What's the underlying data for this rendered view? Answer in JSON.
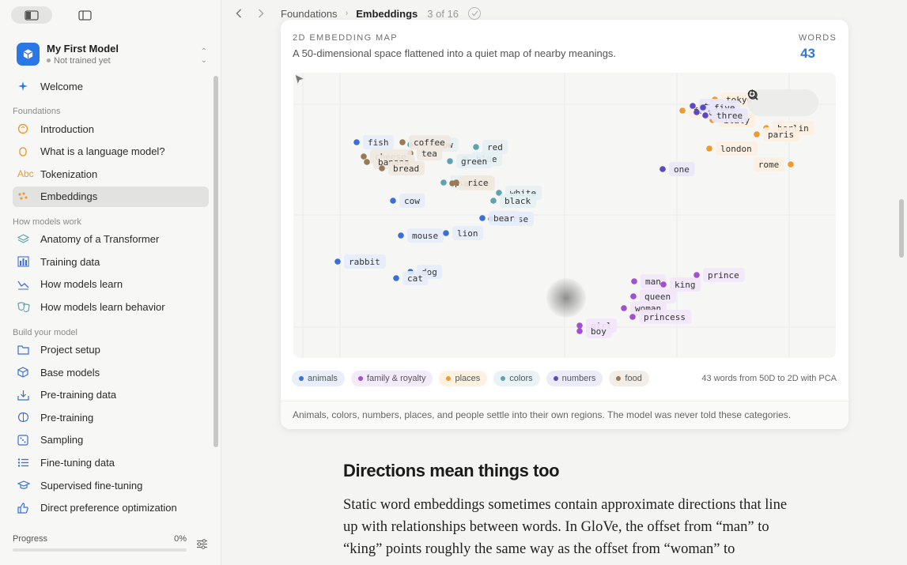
{
  "sidebar": {
    "model_name": "My First Model",
    "model_status": "Not trained yet",
    "welcome": "Welcome",
    "sections": [
      {
        "title": "Foundations",
        "items": [
          "Introduction",
          "What is a language model?",
          "Tokenization",
          "Embeddings"
        ]
      },
      {
        "title": "How models work",
        "items": [
          "Anatomy of a Transformer",
          "Training data",
          "How models learn",
          "How models learn behavior"
        ]
      },
      {
        "title": "Build your model",
        "items": [
          "Project setup",
          "Base models",
          "Pre-training data",
          "Pre-training",
          "Sampling",
          "Fine-tuning data",
          "Supervised fine-tuning",
          "Direct preference optimization"
        ]
      }
    ],
    "active_item": "Embeddings",
    "tokenization_icon_text": "Abc",
    "progress_label": "Progress",
    "progress_value": "0%",
    "progress_fraction": 0
  },
  "header": {
    "crumb_parent": "Foundations",
    "crumb_current": "Embeddings",
    "pager": "3 of 16"
  },
  "card": {
    "label": "2D EMBEDDING MAP",
    "subtitle": "A 50-dimensional space flattened into a quiet map of nearby meanings.",
    "words_label": "WORDS",
    "words_value": "43",
    "legend": [
      {
        "name": "animals",
        "color": "#3a6fd8"
      },
      {
        "name": "family & royalty",
        "color": "#a24fd1"
      },
      {
        "name": "places",
        "color": "#ef9a2f"
      },
      {
        "name": "colors",
        "color": "#5fa2b2"
      },
      {
        "name": "numbers",
        "color": "#5b48c4"
      },
      {
        "name": "food",
        "color": "#9a7a55"
      }
    ],
    "legend_note": "43 words from 50D to 2D with PCA",
    "footer": "Animals, colors, numbers, places, and people settle into their own regions. The model was never told these categories."
  },
  "chart_data": {
    "type": "scatter",
    "points": [
      {
        "word": "fish",
        "group": "animals"
      },
      {
        "word": "cow",
        "group": "animals"
      },
      {
        "word": "mouse",
        "group": "animals"
      },
      {
        "word": "lion",
        "group": "animals"
      },
      {
        "word": "rabbit",
        "group": "animals"
      },
      {
        "word": "dog",
        "group": "animals"
      },
      {
        "word": "cat",
        "group": "animals"
      },
      {
        "word": "horse",
        "group": "animals"
      },
      {
        "word": "bear",
        "group": "animals"
      },
      {
        "word": "man",
        "group": "family"
      },
      {
        "word": "king",
        "group": "family"
      },
      {
        "word": "prince",
        "group": "family"
      },
      {
        "word": "queen",
        "group": "family"
      },
      {
        "word": "woman",
        "group": "family"
      },
      {
        "word": "princess",
        "group": "family"
      },
      {
        "word": "girl",
        "group": "family"
      },
      {
        "word": "boy",
        "group": "family"
      },
      {
        "word": "tokyo",
        "group": "places"
      },
      {
        "word": "france",
        "group": "places"
      },
      {
        "word": "italy",
        "group": "places"
      },
      {
        "word": "berlin",
        "group": "places"
      },
      {
        "word": "paris",
        "group": "places"
      },
      {
        "word": "london",
        "group": "places"
      },
      {
        "word": "rome",
        "group": "places"
      },
      {
        "word": "red",
        "group": "colors"
      },
      {
        "word": "yellow",
        "group": "colors"
      },
      {
        "word": "blue",
        "group": "colors"
      },
      {
        "word": "green",
        "group": "colors"
      },
      {
        "word": "white",
        "group": "colors"
      },
      {
        "word": "black",
        "group": "colors"
      },
      {
        "word": "purple",
        "group": "colors"
      },
      {
        "word": "one",
        "group": "numbers"
      },
      {
        "word": "two",
        "group": "numbers"
      },
      {
        "word": "three",
        "group": "numbers"
      },
      {
        "word": "five",
        "group": "numbers"
      },
      {
        "word": "three",
        "group": "numbers"
      },
      {
        "word": "coffee",
        "group": "food"
      },
      {
        "word": "tea",
        "group": "food"
      },
      {
        "word": "cheese",
        "group": "food"
      },
      {
        "word": "banana",
        "group": "food"
      },
      {
        "word": "bread",
        "group": "food"
      },
      {
        "word": "apple",
        "group": "food"
      },
      {
        "word": "rice",
        "group": "food"
      }
    ]
  },
  "article": {
    "heading": "Directions mean things too",
    "body": "Static word embeddings sometimes contain approximate directions that line up with relationships between words. In GloVe, the offset from “man” to “king” points roughly the same way as the offset from “woman” to"
  }
}
